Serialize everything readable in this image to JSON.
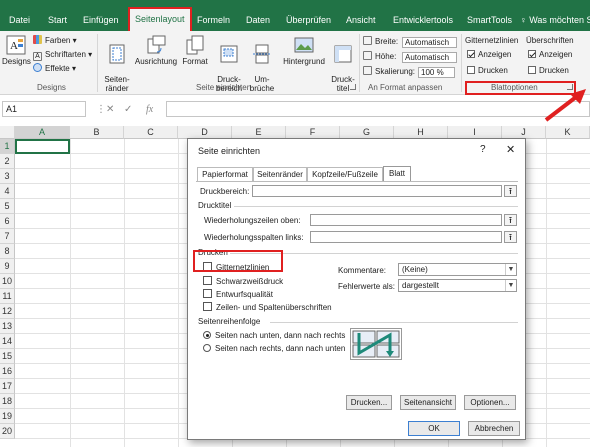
{
  "ribbon_tabs": [
    "Datei",
    "Start",
    "Einfügen",
    "Seitenlayout",
    "Formeln",
    "Daten",
    "Überprüfen",
    "Ansicht",
    "Entwicklertools",
    "SmartTools"
  ],
  "tell_me": "Was möchten S",
  "designs": {
    "designs_label": "Designs",
    "farben": "Farben",
    "schriftarten": "Schriftarten",
    "effekte": "Effekte",
    "group": "Designs"
  },
  "seite_einrichten": {
    "buttons": [
      {
        "label": "Seiten-\nränder"
      },
      {
        "label": "Ausrichtung"
      },
      {
        "label": "Format"
      },
      {
        "label": "Druck-\nbereich"
      },
      {
        "label": "Um-\nbrüche"
      },
      {
        "label": "Hintergrund"
      },
      {
        "label": "Druck-\ntitel"
      }
    ],
    "group": "Seite einrichten"
  },
  "an_format": {
    "breite": "Breite:",
    "breite_val": "Automatisch",
    "hoehe": "Höhe:",
    "hoehe_val": "Automatisch",
    "skalierung": "Skalierung:",
    "skalierung_val": "100 %",
    "group": "An Format anpassen"
  },
  "blattoptionen": {
    "gitternetzlinien": "Gitternetzlinien",
    "ueberschriften": "Überschriften",
    "anzeigen": "Anzeigen",
    "drucken": "Drucken",
    "group": "Blattoptionen",
    "gitter_anzeigen": true,
    "gitter_drucken": false,
    "ueber_anzeigen": true,
    "ueber_drucken": false
  },
  "formula_bar": {
    "namebox": "A1",
    "fx": "fx"
  },
  "columns": [
    "A",
    "B",
    "C",
    "D",
    "E",
    "F",
    "G",
    "H",
    "I",
    "J",
    "K"
  ],
  "rows": [
    "1",
    "2",
    "3",
    "4",
    "5",
    "6",
    "7",
    "8",
    "9",
    "10",
    "11",
    "12",
    "13",
    "14",
    "15",
    "16",
    "17",
    "18",
    "19",
    "20"
  ],
  "dialog": {
    "title": "Seite einrichten",
    "help": "?",
    "tabs": [
      "Papierformat",
      "Seitenränder",
      "Kopfzeile/Fußzeile",
      "Blatt"
    ],
    "active_tab": "Blatt",
    "druckbereich": "Druckbereich:",
    "drucktitel": "Drucktitel",
    "wdh_zeilen": "Wiederholungszeilen oben:",
    "wdh_spalten": "Wiederholungsspalten links:",
    "drucken_section": "Drucken",
    "chk_gitter": "Gitternetzlinien",
    "chk_schwarzweiss": "Schwarzweißdruck",
    "chk_entwurf": "Entwurfsqualität",
    "chk_zeilen": "Zeilen- und Spaltenüberschriften",
    "kommentare_label": "Kommentare:",
    "kommentare_value": "(Keine)",
    "fehlerwerte_label": "Fehlerwerte als:",
    "fehlerwerte_value": "dargestellt",
    "seitenreihenfolge": "Seitenreihenfolge",
    "radio1": "Seiten nach unten, dann nach rechts",
    "radio2": "Seiten nach rechts, dann nach unten",
    "btn_drucken": "Drucken...",
    "btn_seitenansicht": "Seitenansicht",
    "btn_optionen": "Optionen...",
    "btn_ok": "OK",
    "btn_abbrechen": "Abbrechen"
  },
  "colors": {
    "excel_green": "#217346",
    "highlight_red": "#e02020"
  }
}
